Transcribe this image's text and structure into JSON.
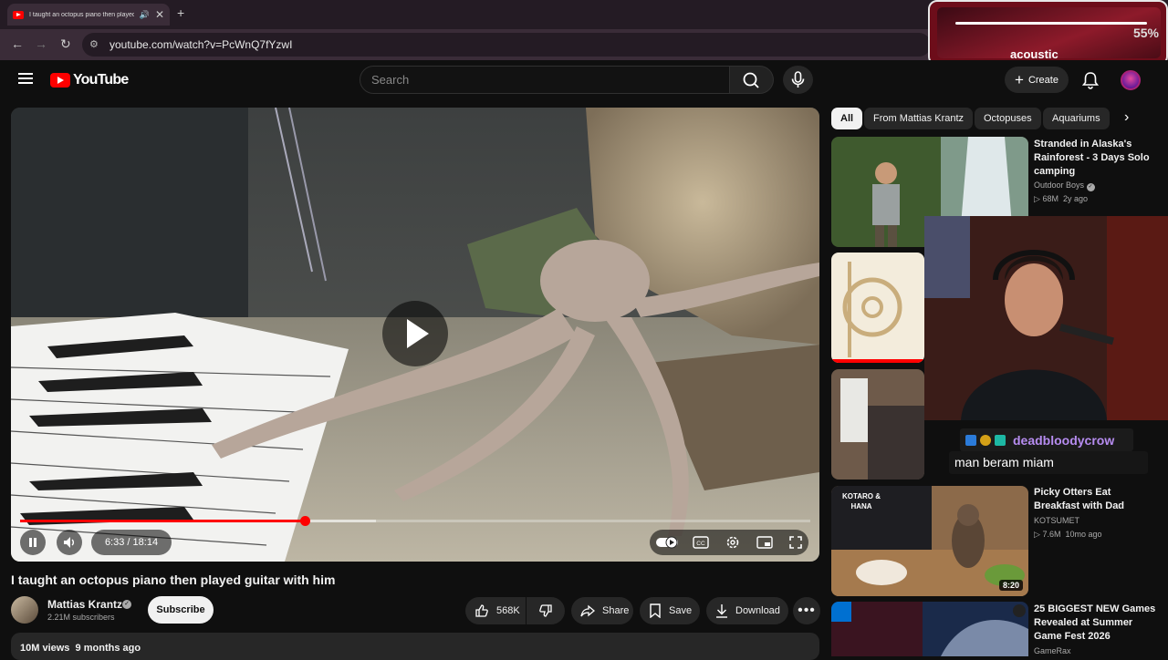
{
  "browser": {
    "tab_title": "I taught an octopus piano then played guitar with him",
    "url": "youtube.com/watch?v=PcWnQ7fYzwI"
  },
  "overlay_widget": {
    "percent": "55%",
    "label": "acoustic"
  },
  "youtube": {
    "logo_text": "YouTube",
    "search_placeholder": "Search",
    "create_label": "Create"
  },
  "player": {
    "current_time": "6:33",
    "separator": " / ",
    "duration": "18:14",
    "progress_fraction": 0.36,
    "buffer_fraction": 0.45
  },
  "video": {
    "title": "I taught an octopus piano then played guitar with him",
    "channel": "Mattias Krantz",
    "subscribers": "2.21M subscribers",
    "subscribe_label": "Subscribe",
    "likes": "568K",
    "share_label": "Share",
    "save_label": "Save",
    "download_label": "Download",
    "views": "10M views",
    "age": "9 months ago"
  },
  "chips": [
    "All",
    "From Mattias Krantz",
    "Octopuses",
    "Aquariums"
  ],
  "recommendations": [
    {
      "title": "Stranded in Alaska's Rainforest - 3 Days Solo camping",
      "channel": "Outdoor Boys",
      "views": "68M",
      "age": "2y ago"
    },
    {
      "title": "Picky Otters Eat Breakfast with Dad",
      "channel": "KOTSUMET",
      "views": "7.6M",
      "age": "10mo ago",
      "duration": "8:20"
    },
    {
      "title": "25 BIGGEST NEW Games Revealed at Summer Game Fest 2026",
      "channel": "GameRax"
    }
  ],
  "thumb_texts": {
    "otters_caption": "KOTARO & HANA"
  },
  "chat": {
    "username": "deadbloodycrow",
    "message": "man beram miam"
  },
  "colors": {
    "accent_red": "#ff0000",
    "background": "#0f0f0f"
  }
}
